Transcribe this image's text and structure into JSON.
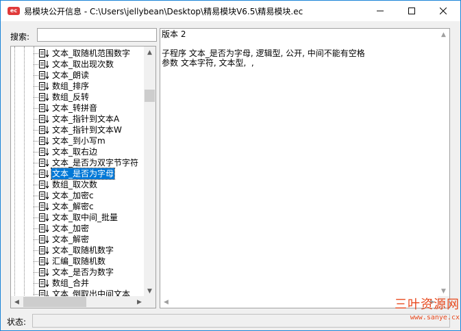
{
  "window": {
    "title": "易模块公开信息 - C:\\Users\\jellybean\\Desktop\\精易模块V6.5\\精易模块.ec",
    "icon_text": "ec",
    "controls": [
      "minimize-icon",
      "maximize-icon",
      "close-icon"
    ]
  },
  "search": {
    "label": "搜索:",
    "value": ""
  },
  "tree": {
    "items": [
      {
        "label": "文本_取随机范围数字",
        "selected": false
      },
      {
        "label": "文本_取出现次数",
        "selected": false
      },
      {
        "label": "文本_朗读",
        "selected": false
      },
      {
        "label": "数组_排序",
        "selected": false
      },
      {
        "label": "数组_反转",
        "selected": false
      },
      {
        "label": "文本_转拼音",
        "selected": false
      },
      {
        "label": "文本_指针到文本A",
        "selected": false
      },
      {
        "label": "文本_指针到文本W",
        "selected": false
      },
      {
        "label": "文本_到小写m",
        "selected": false
      },
      {
        "label": "文本_取右边",
        "selected": false
      },
      {
        "label": "文本_是否为双字节字符",
        "selected": false
      },
      {
        "label": "文本_是否为字母",
        "selected": true
      },
      {
        "label": "数组_取次数",
        "selected": false
      },
      {
        "label": "文本_加密c",
        "selected": false
      },
      {
        "label": "文本_解密c",
        "selected": false
      },
      {
        "label": "文本_取中间_批量",
        "selected": false
      },
      {
        "label": "文本_加密",
        "selected": false
      },
      {
        "label": "文本_解密",
        "selected": false
      },
      {
        "label": "文本_取随机数字",
        "selected": false
      },
      {
        "label": "汇编_取随机数",
        "selected": false
      },
      {
        "label": "文本_是否为数字",
        "selected": false
      },
      {
        "label": "数组_合并",
        "selected": false
      },
      {
        "label": "文本_倒取出中间文本",
        "selected": false
      }
    ],
    "item_icon": "function-doc-icon"
  },
  "content": {
    "lines": [
      "版本 2",
      "",
      "子程序 文本_是否为字母, 逻辑型, 公开, 中间不能有空格",
      "参数 文本字符, 文本型,  ,"
    ]
  },
  "status": {
    "label": "状态:",
    "value": ""
  },
  "watermark": {
    "title": "三叶资源网",
    "url": "www.sanye.cx"
  }
}
